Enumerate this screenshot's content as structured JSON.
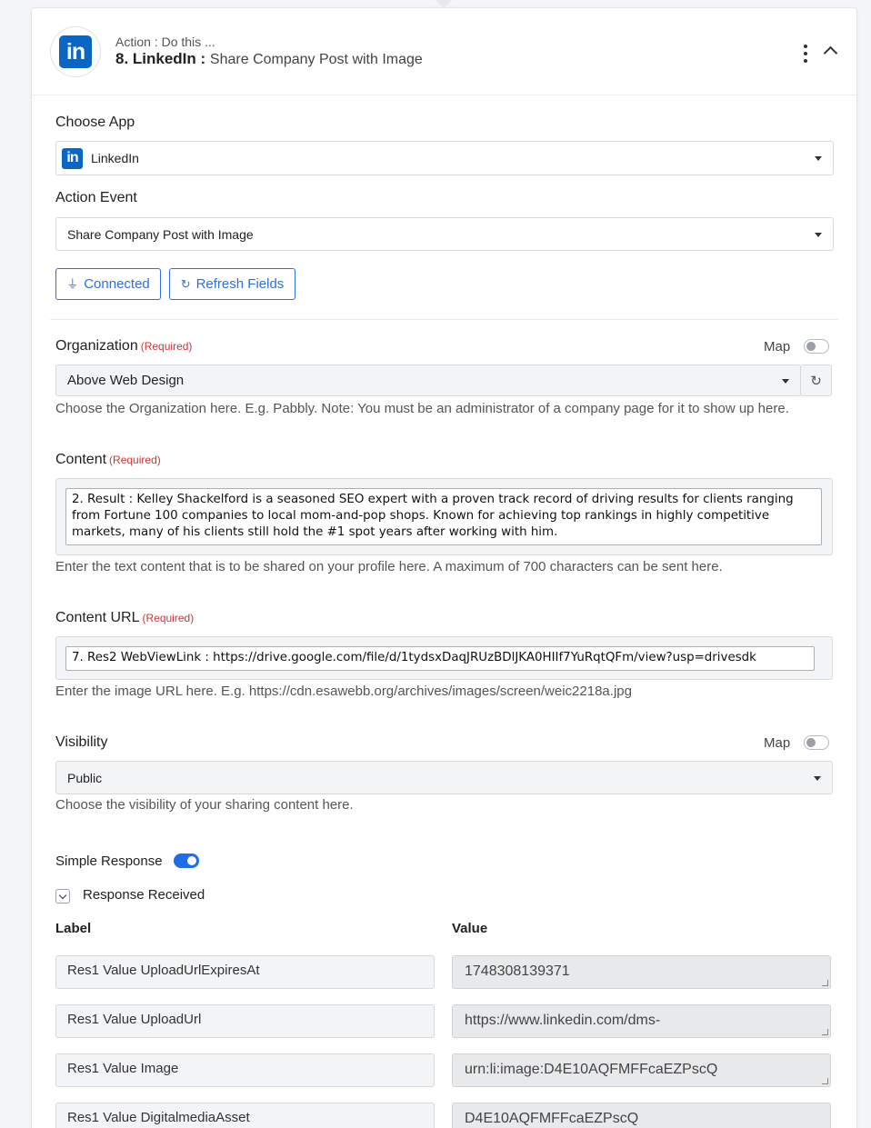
{
  "header": {
    "action_label": "Action : Do this ...",
    "step": "8. LinkedIn :",
    "event": "Share Company Post with Image",
    "logo_text": "in"
  },
  "choose_app": {
    "label": "Choose App",
    "value": "LinkedIn"
  },
  "action_event": {
    "label": "Action Event",
    "value": "Share Company Post with Image"
  },
  "buttons": {
    "connected": "Connected",
    "refresh_fields": "Refresh Fields"
  },
  "organization": {
    "label": "Organization",
    "required": "(Required)",
    "map_label": "Map",
    "value": "Above Web Design",
    "help": "Choose the Organization here. E.g. Pabbly. Note: You must be an administrator of a company page for it to show up here."
  },
  "content": {
    "label": "Content",
    "required": "(Required)",
    "value": "2. Result : Kelley Shackelford is a seasoned SEO expert with a proven track record of driving results for clients ranging from Fortune 100 companies to local mom-and-pop shops. Known for achieving top rankings in highly competitive markets, many of his clients still hold the #1 spot years after working with him.",
    "help": "Enter the text content that is to be shared on your profile here. A maximum of 700 characters can be sent here."
  },
  "content_url": {
    "label": "Content URL",
    "required": "(Required)",
    "value": "7. Res2 WebViewLink : https://drive.google.com/file/d/1tydsxDaqJRUzBDlJKA0HIIf7YuRqtQFm/view?usp=drivesdk",
    "help": "Enter the image URL here. E.g. https://cdn.esawebb.org/archives/images/screen/weic2218a.jpg"
  },
  "visibility": {
    "label": "Visibility",
    "map_label": "Map",
    "value": "Public",
    "help": "Choose the visibility of your sharing content here."
  },
  "simple_response": {
    "label": "Simple Response",
    "enabled": true
  },
  "response_received": {
    "label": "Response Received",
    "col_label": "Label",
    "col_value": "Value",
    "rows": [
      {
        "label": "Res1 Value UploadUrlExpiresAt",
        "value": "1748308139371"
      },
      {
        "label": "Res1 Value UploadUrl",
        "value": "https://www.linkedin.com/dms-"
      },
      {
        "label": "Res1 Value Image",
        "value": "urn:li:image:D4E10AQFMFFcaEZPscQ"
      },
      {
        "label": "Res1 Value DigitalmediaAsset",
        "value": "D4E10AQFMFFcaEZPscQ"
      }
    ]
  }
}
